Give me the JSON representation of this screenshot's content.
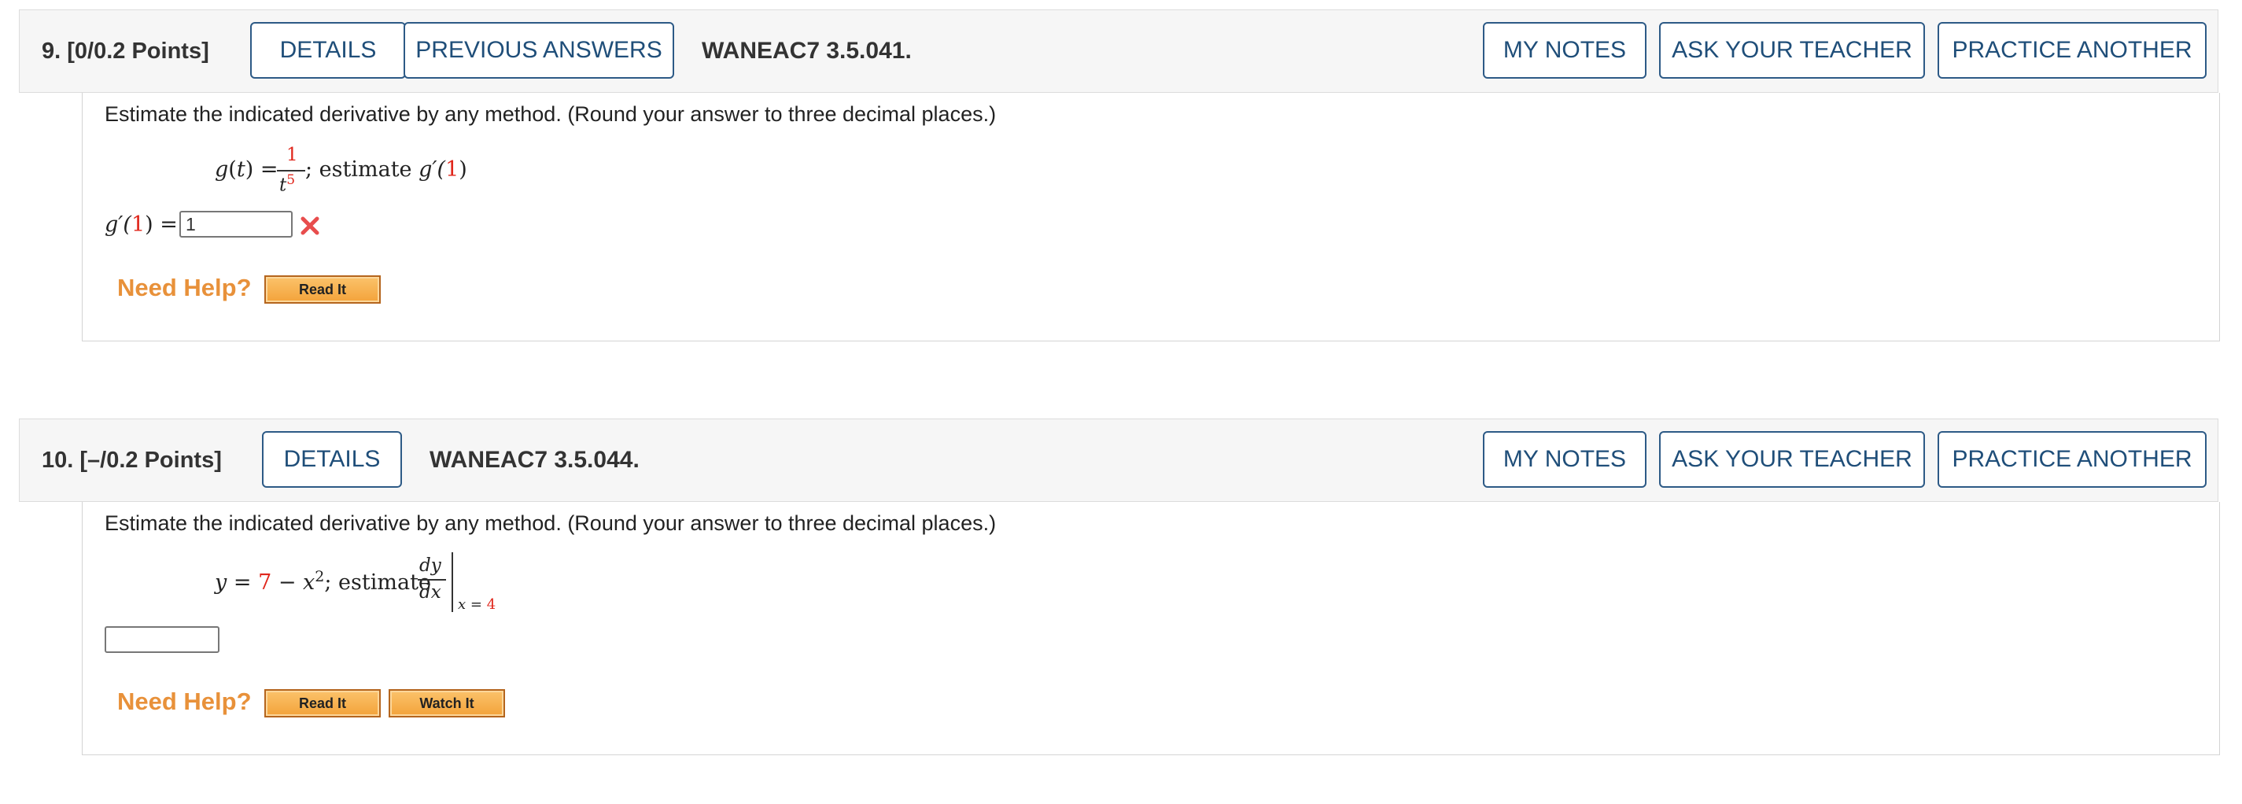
{
  "questions": [
    {
      "title": "9.  [0/0.2 Points]",
      "buttons": {
        "details": "DETAILS",
        "previous_answers": "PREVIOUS ANSWERS",
        "my_notes": "MY NOTES",
        "ask_teacher": "ASK YOUR TEACHER",
        "practice_another": "PRACTICE ANOTHER"
      },
      "source": "WANEAC7 3.5.041.",
      "instructions": "Estimate the indicated derivative by any method. (Round your answer to three decimal places.)",
      "formula": {
        "lhs": "g(t) =",
        "numerator": "1",
        "denominator_base": "t",
        "denominator_exp": "5",
        "estimate_text": "; estimate ",
        "estimate_fn": "g′(",
        "estimate_arg": "1",
        "estimate_close": ")"
      },
      "answer": {
        "label_fn": "g′(",
        "label_arg": "1",
        "label_close": ") =",
        "value": "1",
        "status": "incorrect",
        "status_icon": "x-mark-icon",
        "status_color": "#e84d4d"
      },
      "help": {
        "label": "Need Help?",
        "read_it": "Read It"
      }
    },
    {
      "title": "10.  [–/0.2 Points]",
      "buttons": {
        "details": "DETAILS",
        "my_notes": "MY NOTES",
        "ask_teacher": "ASK YOUR TEACHER",
        "practice_another": "PRACTICE ANOTHER"
      },
      "source": "WANEAC7 3.5.044.",
      "instructions": "Estimate the indicated derivative by any method. (Round your answer to three decimal places.)",
      "formula": {
        "lhs": "y = ",
        "const": "7",
        "minus": " − ",
        "var": "x",
        "exp": "2",
        "estimate_text": "; estimate ",
        "deriv_num": "dy",
        "deriv_den": "dx",
        "eval_var": "x = ",
        "eval_val": "4"
      },
      "answer": {
        "value": "",
        "placeholder": ""
      },
      "help": {
        "label": "Need Help?",
        "read_it": "Read It",
        "watch_it": "Watch It"
      }
    }
  ],
  "colors": {
    "accent_blue": "#1f4e79",
    "highlight_red": "#e0261b",
    "help_orange": "#e8913a",
    "button_gold": "#f3a33a"
  }
}
